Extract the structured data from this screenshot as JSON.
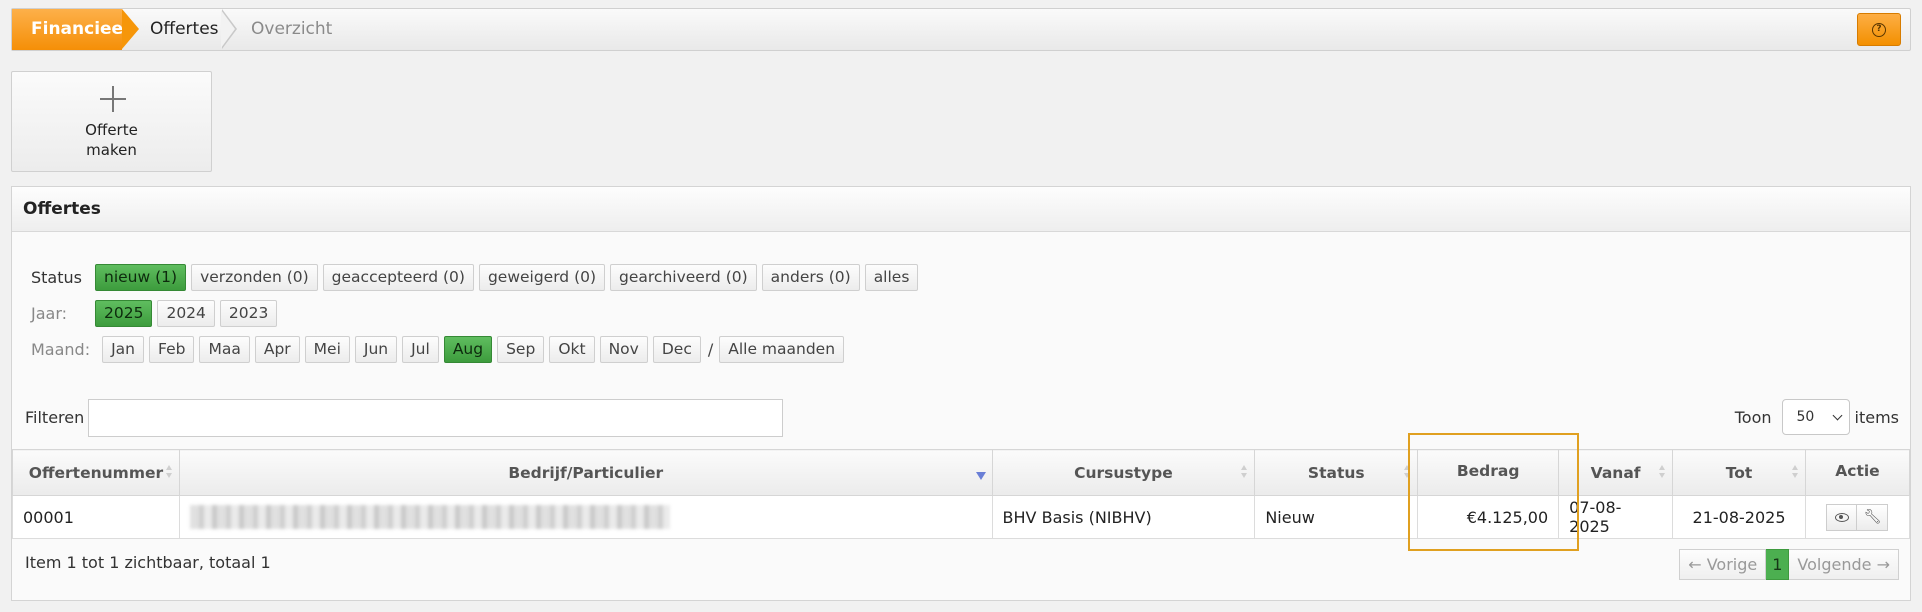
{
  "breadcrumb": {
    "items": [
      "Financieel",
      "Offertes",
      "Overzicht"
    ],
    "help_icon": "?"
  },
  "create": {
    "label_line1": "Offerte",
    "label_line2": "maken"
  },
  "panel": {
    "title": "Offertes",
    "status": {
      "label": "Status",
      "chips": [
        "nieuw (1)",
        "verzonden (0)",
        "geaccepteerd (0)",
        "geweigerd (0)",
        "gearchiveerd (0)",
        "anders (0)",
        "alles"
      ],
      "active_index": 0
    },
    "year": {
      "label": "Jaar:",
      "chips": [
        "2025",
        "2024",
        "2023"
      ],
      "active_index": 0
    },
    "month": {
      "label": "Maand:",
      "chips": [
        "Jan",
        "Feb",
        "Maa",
        "Apr",
        "Mei",
        "Jun",
        "Jul",
        "Aug",
        "Sep",
        "Okt",
        "Nov",
        "Dec"
      ],
      "active_index": 7,
      "separator": "/",
      "all_label": "Alle maanden"
    },
    "filter": {
      "label": "Filteren",
      "value": ""
    },
    "show": {
      "label": "Toon",
      "value": "50",
      "suffix": "items"
    }
  },
  "table": {
    "headers": [
      "Offertenummer",
      "Bedrijf/Particulier",
      "Cursustype",
      "Status",
      "Bedrag",
      "Vanaf",
      "Tot",
      "Actie"
    ],
    "rows": [
      {
        "nummer": "00001",
        "bedrijf": "",
        "cursustype": "BHV Basis (NIBHV)",
        "status": "Nieuw",
        "bedrag": "€4.125,00",
        "vanaf": "07-08-2025",
        "tot": "21-08-2025"
      }
    ]
  },
  "footer": {
    "summary": "Item 1 tot 1 zichtbaar, totaal 1",
    "prev": "← Vorige",
    "page": "1",
    "next": "Volgende →"
  },
  "colors": {
    "accent": "#f7950a",
    "active_chip": "#4caf50",
    "highlight": "#e0a020"
  }
}
